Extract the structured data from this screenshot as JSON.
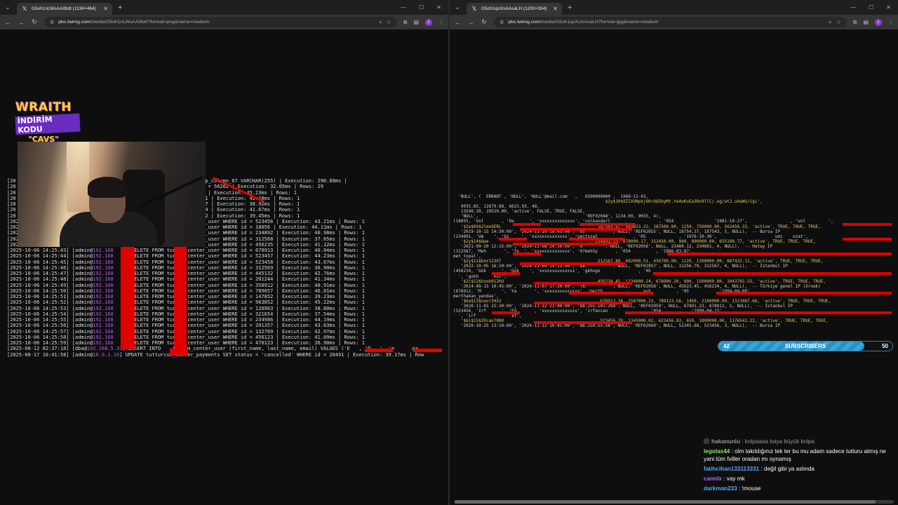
{
  "left_window": {
    "tab_title": "G5oh1nLWsAA0bdI (1134×464)",
    "url_host": "pbs.twimg.com",
    "url_path": "/media/G5oh1nLWsAA0bdI?format=png&name=medium"
  },
  "right_window": {
    "tab_title": "G5oh1qoXsAAsaLH (1200×354)",
    "url_host": "pbs.twimg.com",
    "url_path": "/media/G5oh1qoXsAAsaLH?format=jpg&name=medium"
  },
  "overlay": {
    "brand": "WRAITH",
    "promo": "İNDİRİM KODU",
    "code": "\"CAVS\""
  },
  "terminal": {
    "lines": [
      "[20                                    m_center_user ADD COLUMN temp_column_87 VARCHAR(255) | Execution: 290.88ms |",
      "[20                                    center_transactions WHERE id = 56202 | Execution: 32.05ms | Rows: 29",
      "[20                                    center_user WHERE id = 18055 | Execution: 45.23ms | Rows: 1",
      "[20                                    center_user WHERE id = 234891 | Execution: 42.18ms | Rows: 1",
      "[20                                    center_user WHERE id = 312567 | Execution: 38.92ms | Rows: 1",
      "[20                                    center_user WHERE id = 456234 | Execution: 41.67ms | Rows: 1",
      "[20                                    center_user WHERE id = 678912 | Execution: 39.45ms | Rows: 1",
      "[2025-10-06 14:25:20] [admin@192.168      DELETE FROM turcom_center_user WHERE id = 523456 | Execution: 43.21ms | Rows: 1",
      "[2025-10-06 14:25:39] [admin@192.168      DELETE FROM turcom_center_user WHERE id = 18056 | Execution: 44.11ms | Rows: 1",
      "[2025-10-06 14:25:40] [admin@192.168      DELETE FROM turcom_center_user WHERE id = 234892 | Execution: 40.98ms | Rows: 1",
      "[2025-10-06 14:25:41] [admin@192.168      DELETE FROM turcom_center_user WHERE id = 312568 | Execution: 37.65ms | Rows: 1",
      "[2025-10-06 14:25:42] [admin@192.168      DELETE FROM turcom_center_user WHERE id = 456235 | Execution: 41.12ms | Rows: 1",
      "[2025-10-06 14:25:43] [admin@192.168      DELETE FROM turcom_center_user WHERE id = 678913 | Execution: 40.04ms | Rows: 1",
      "[2025-10-06 14:25:44] [admin@192.168      DELETE FROM turcom_center_user WHERE id = 523457 | Execution: 44.23ms | Rows: 1",
      "[2025-10-06 14:25:45] [admin@192.168      DELETE FROM turcom_center_user WHERE id = 523458 | Execution: 43.67ms | Rows: 1",
      "[2025-10-06 14:25:46] [admin@192.168      DELETE FROM turcom_center_user WHERE id = 312569 | Execution: 36.90ms | Rows: 1",
      "[2025-10-06 14:25:47] [admin@192.168      DELETE FROM turcom_center_user WHERE id = 445132 | Execution: 42.76ms | Rows: 1",
      "[2025-10-06 14:25:48] [admin@192.168      DELETE FROM turcom_center_user WHERE id = 201244 | Execution: 41.34ms | Rows: 1",
      "[2025-10-06 14:25:49] [admin@192.168      DELETE FROM turcom_center_user WHERE id = 358912 | Execution: 40.91ms | Rows: 1",
      "[2025-10-06 14:25:50] [admin@192.168      DELETE FROM turcom_center_user WHERE id = 789657 | Execution: 46.01ms | Rows: 1",
      "[2025-10-06 14:25:51] [admin@192.168      DELETE FROM turcom_center_user WHERE id = 147852 | Execution: 39.23ms | Rows: 1",
      "[2025-10-06 14:25:52] [admin@192.168      DELETE FROM turcom_center_user WHERE id = 963852 | Execution: 45.22ms | Rows: 1",
      "[2025-10-06 14:25:53] [admin@192.168      DELETE FROM turcom_center_user WHERE id = 128963 | Execution: 38.80ms | Rows: 1",
      "[2025-10-06 14:25:54] [admin@192.168      DELETE FROM turcom_center_user WHERE id = 321654 | Execution: 37.54ms | Rows: 1",
      "[2025-10-06 14:25:55] [admin@192.168      DELETE FROM turcom_center_user WHERE id = 234986 | Execution: 44.19ms | Rows: 1",
      "[2025-10-06 14:25:56] [admin@192.168      DELETE FROM turcom_center_user WHERE id = 201357 | Execution: 43.63ms | Rows: 1",
      "[2025-10-06 14:25:57] [admin@192.168      DELETE FROM turcom_center_user WHERE id = 132789 | Execution: 42.97ms | Rows: 1",
      "[2025-10-06 14:25:58] [admin@192.168      DELETE FROM turcom_center_user WHERE id = 456123 | Execution: 41.09ms | Rows: 1",
      "[2025-10-06 14:25:59] [admin@192.168      DELETE FROM turcom_center_user WHERE id = 470123 | Execution: 36.90ms | Rows: 1",
      "[2025-08-12 02:37:18] [dba@192.168.5.33] INSERT INTO    turcom_center_user (first_name, last_name, email) VALUES ('E   , 'D   ', 'e      ga",
      "[2025-08-17 10:41:58] [admin@10.0.1.10] UPDATE tutturcom_center_payments SET status = 'cancelled' WHERE id = 20491 | Execution: 39.17ms | Row"
    ]
  },
  "query": {
    "lines": [
      "  'NULL', (  ERRANT , 'NULL', 'NULL'@mail.com   ,   0500000000 ,  1960-12-03,",
      "                                                            $2y$10$9ZIXUNpkjO0rOQ5byMt.Ye4oKoEa3Ro9llC/.og/at2.uheWG/igi',",
      "   9035.85, 12879.88, 6623.93, 48,",
      "   13598.39, 10520.00, 'active', FALSE, TRUE, FALSE,",
      "   'NULL',                                          'REF02048', 1134.09, 9035, 4),",
      "",
      "(18055, 'Vol       , 'De      ', 'xxxxxxxxxxxxxx', 'volkandarl                   , '054                '1981-10-27',                 , 'vol         ',",
      "   '$2a$09$2lmnOERL                                    , 187543.67, 485623.32, 187500.00, 1250, 750000.00, 562456.33, 'active', TRUE, TRUE, TRUE,",
      "   '2019-10-15 14:30:00', '2024-11-10 18:45:00', '05          ', NULL, 'REF02055', NULL, 18754.37, 187543, 5, NULL),  -- Bursa IP",
      "(234891, 'Um    ', 'Oz     ', 'xxxxxxxxxxxxxx', 'umitozat              , '05             , '1976-10-30',                       umi    ozat',",
      "   '$2y$14$Qwe                                        , 234891.23, 678000.17, 312450.00, 980, 890000.00, 655108.77, 'active', TRUE, TRUE, TRUE,",
      "   '2021-09-20 12:15:00', '2024-11-08 20:30:00', '0        ', NULL, 'REF02056', NULL, 23489.12, 234891, 4, NULL),  -- Hatay IP",
      "(312567, 'Meh       ', 'To  ', 'xxxxxxxxxxxxxx', '07mehtp       , '054          , '1986-03-07',",
      "met_topal',",
      "   '$2y$11$bar123XT                                     ,312567.89, 892000.51, 456789.00, 1120, 1200000.00, 887432.11, 'active', TRUE, TRUE, TRUE,",
      "   '2022-10-05 16:20:00', '2024-11-09 19:15:00', '88.          , NULL, 'REF02057', NULL, 31256.79, 312567, 4, NULL),  -- İstanbul IP",
      "(456234, 'Gök      ', 'Gök    ', 'xxxxxxxxxxxxxx', 'gkhngo               , '05                  ,",
      "  ', 'gokh      nul',",
      "   '$2c$12$hook012HU                                    ,456234.45, 1234000.24, 678900.20, 800, 1500000.00, 1043765.55, 'active', TRUE, TRUE, TRUE,",
      "   '2014-09-15 10:45:00', '2024-11-07 17:20:00', '78.          , NULL, 'REF02058', NULL, 45623.45, 456234, 4, NULL),  -- Türkiye genel IP (örnek)",
      "(678912, 'M        ', 'Ya       ', 'xxxxxxxxxxxxxx', 'merth                ash          , '05            '1994-04-08',",
      "merthakan_yandas',",
      "   '$6a$13$navr34S2                                      ,678912.34, 1567000.23, 789123.56, 1450, 2100000.00, 1321087.66, 'active', TRUE, TRUE, TRUE,",
      "   '2020-11-01 15:30:00', '2024-11-12 21:00:00', '88.255.101.204', NULL, 'REF02059', NULL, 67891.23, 678912, 5, NULL),  -- İstanbul IP",
      "(523456, 'Irf      ', 'Eğ       , 'xxxxxxxxxxxxxx', 'irfancan               , '054            '1999-04-15',",
      "  ', 'irf              at',",
      "   '$6i$15$IRcan70NU                                     ,523456.78, 1345000.02, 623456.83, 650, 1800000.00, 1176543.22, 'active', TRUE, TRUE, TRUE,",
      "   '2020-10-25 13:10:00', '2024-11-11 16:45:00', '88.250.55.58', NULL, 'REF02060', NULL, 52345.68, 523456, 3, NULL),  -- Bursa IP"
    ]
  },
  "subscribers": {
    "current": "42",
    "label": "SUBSCRIBERS",
    "goal": "50",
    "progress_fraction": 0.84
  },
  "chat": [
    {
      "user": "hakanunlu",
      "text": "kolpaaaa baya büyük kolpa",
      "color": "#ffffff",
      "dim": true
    },
    {
      "user": "legolas44",
      "text": "olm takıldığınız tek ter bu mu adam sadece tutturu atmış ne yani tüm fviller oradan mı oynamış",
      "color": "#8ee66a",
      "dim": false
    },
    {
      "user": "fatihcihan133113331",
      "text": "değil gibi ya aslında",
      "color": "#5aa8ff",
      "dim": false
    },
    {
      "user": "cannlx",
      "text": "vay mk",
      "color": "#b06cff",
      "dim": false
    },
    {
      "user": "darkman233",
      "text": "!mouse",
      "color": "#5aa8ff",
      "dim": false
    }
  ],
  "icons": {
    "tab_menu": "chevron-down-icon",
    "tab_favicon": "x-logo-icon",
    "tab_close": "close-icon",
    "new_tab": "plus-icon",
    "back": "back-arrow-icon",
    "forward": "forward-arrow-icon",
    "reload": "reload-icon",
    "site_info": "site-info-icon",
    "zoom": "zoom-icon",
    "bookmark": "star-icon",
    "extensions": "puzzle-icon",
    "profile": "profile-icon",
    "menu": "kebab-menu-icon"
  },
  "colors": {
    "redaction": "#e00000",
    "ip_purple": "#b35cf0",
    "brand_yellow": "#ffd21a",
    "brand_purple": "#6a2bbf",
    "subs_blue": "#35a6d8"
  }
}
